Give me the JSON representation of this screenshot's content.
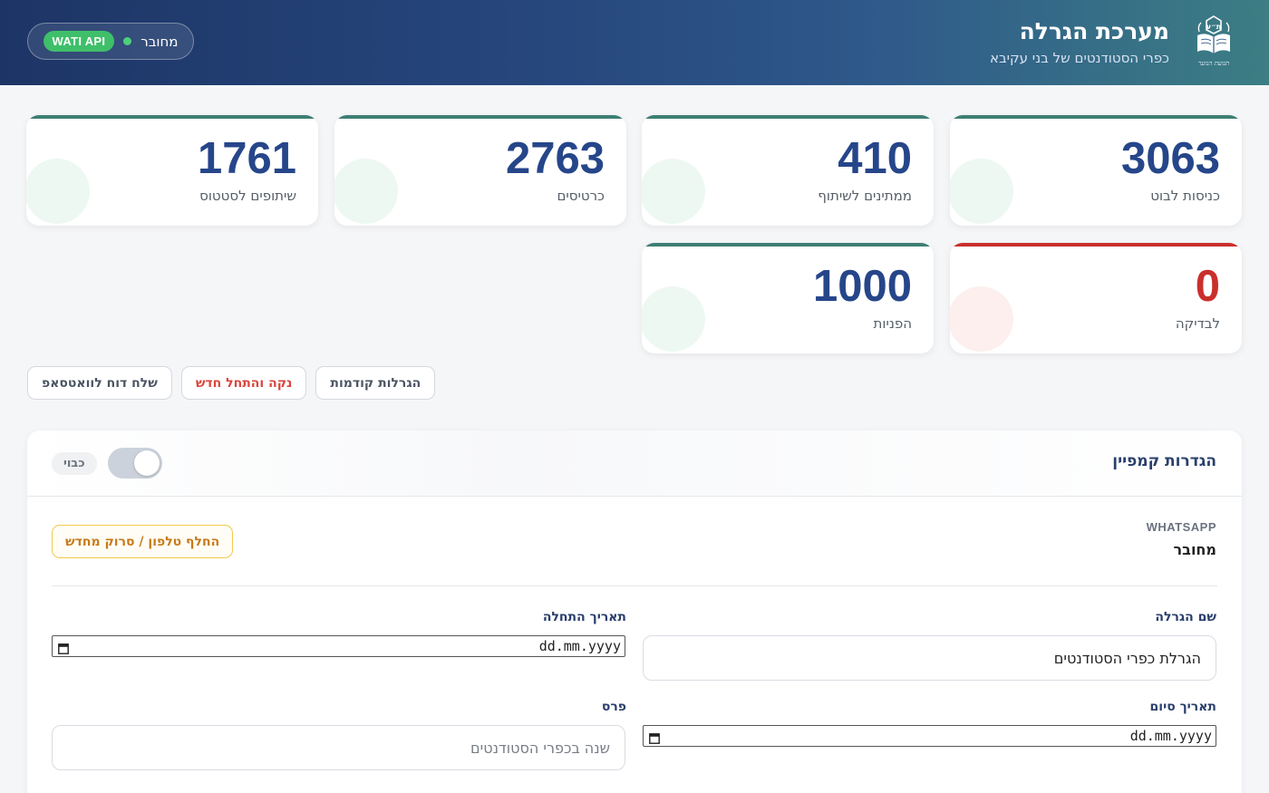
{
  "header": {
    "title": "מערכת הגרלה",
    "subtitle": "כפרי הסטודנטים של בני עקיבא",
    "logo_icon": "book-emblem-icon",
    "logo_letters": "ת״ע",
    "logo_caption": "תנועת הנוער",
    "connection": {
      "label": "מחובר",
      "badge": "WATI API",
      "dot_color": "#4cd07a"
    }
  },
  "stats": [
    {
      "value": "3063",
      "label": "כניסות לבוט",
      "accent": "#3e7f74"
    },
    {
      "value": "410",
      "label": "ממתינים לשיתוף",
      "accent": "#3e7f74"
    },
    {
      "value": "2763",
      "label": "כרטיסים",
      "accent": "#3e7f74"
    },
    {
      "value": "1761",
      "label": "שיתופים לסטטוס",
      "accent": "#3e7f74"
    },
    {
      "value": "0",
      "label": "לבדיקה",
      "accent": "#c9302c"
    },
    {
      "value": "1000",
      "label": "הפניות",
      "accent": "#3e7f74"
    }
  ],
  "actions": {
    "previous": "הגרלות קודמות",
    "reset": "נקה והתחל חדש",
    "report": "שלח דוח לוואטסאפ"
  },
  "campaign": {
    "title": "הגדרות קמפיין",
    "toggle_state": "כבוי",
    "whatsapp_label": "WHATSAPP",
    "whatsapp_status": "מחובר",
    "replace_phone": "החלף טלפון / סרוק מחדש",
    "fields": {
      "name_label": "שם הגרלה",
      "name_value": "הגרלת כפרי הסטודנטים",
      "start_label": "תאריך התחלה",
      "start_value": "dd.mm.yyyy",
      "end_label": "תאריך סיום",
      "end_value": "dd.mm.yyyy",
      "prize_label": "פרס",
      "prize_placeholder": "שנה בכפרי הסטודנטים"
    }
  }
}
